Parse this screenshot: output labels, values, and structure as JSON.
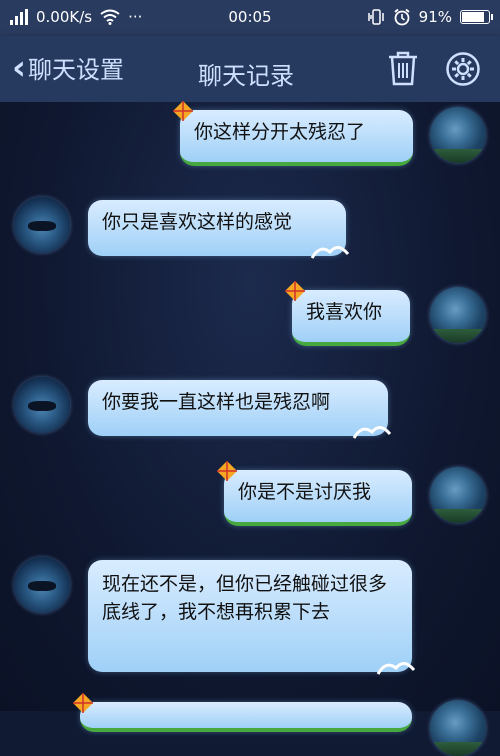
{
  "status_bar": {
    "network_speed": "0.00K/s",
    "more": "···",
    "time": "00:05",
    "battery": "91%",
    "battery_level": 0.91
  },
  "header": {
    "back_label": "聊天设置",
    "title": "聊天记录",
    "trash_icon": "trash-icon",
    "settings_icon": "gear-icon"
  },
  "messages": [
    {
      "side": "self",
      "text": "你这样分开太残忍了"
    },
    {
      "side": "other",
      "text": "你只是喜欢这样的感觉"
    },
    {
      "side": "self",
      "text": "我喜欢你"
    },
    {
      "side": "other",
      "text": "你要我一直这样也是残忍啊"
    },
    {
      "side": "self",
      "text": "你是不是讨厌我"
    },
    {
      "side": "other",
      "text": "现在还不是，但你已经触碰过很多底线了，我不想再积累下去"
    }
  ],
  "colors": {
    "header_bg": "#26395f",
    "chat_bg": "#101a33",
    "bubble_blue": "#a9d6fa",
    "grass_green": "#46a83f"
  }
}
